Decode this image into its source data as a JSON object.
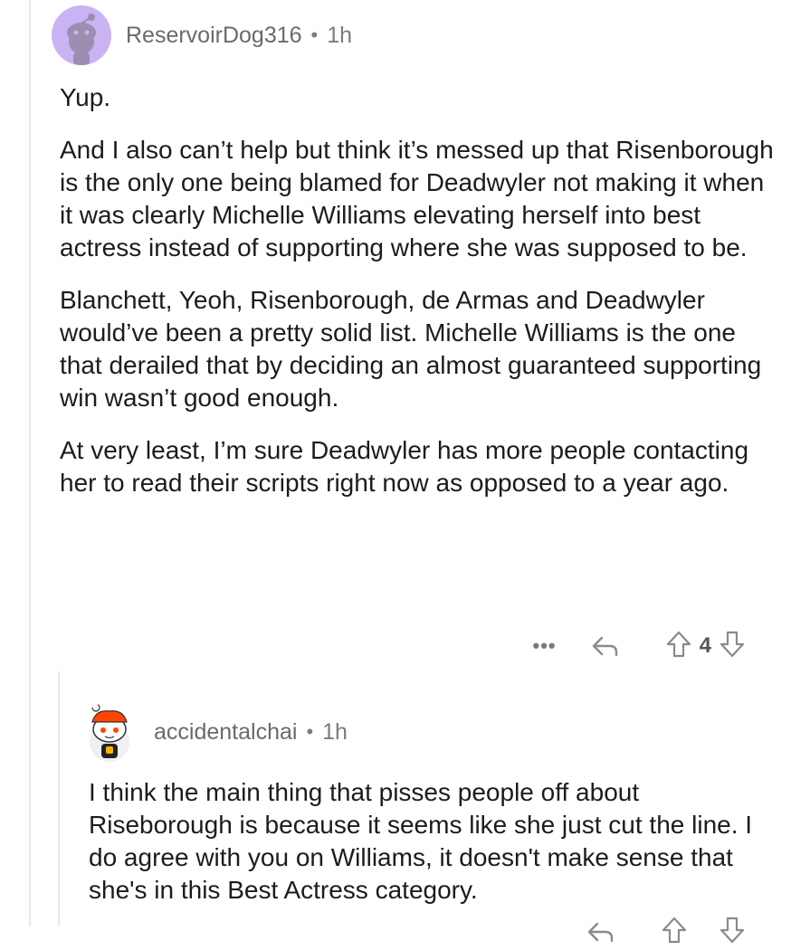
{
  "comments": [
    {
      "username": "ReservoirDog316",
      "separator": "•",
      "time": "1h",
      "paragraphs": [
        "Yup.",
        "And I also can’t help but think it’s messed up that Risenborough is the only one being blamed for Deadwyler not making it when it was clearly Michelle Williams elevating herself into best actress instead of supporting where she was supposed to be.",
        "Blanchett, Yeoh, Risenborough, de Armas and Deadwyler would’ve been a pretty solid list. Michelle Williams is the one that derailed that by deciding an almost guaranteed supporting win wasn’t good enough.",
        "At very least, I’m sure Deadwyler has more people contacting her to read their scripts right now as opposed to a year ago."
      ],
      "actions": {
        "more": "•••",
        "score": "4"
      }
    },
    {
      "username": "accidentalchai",
      "separator": "•",
      "time": "1h",
      "paragraphs": [
        "I think the main thing that pisses people off about Riseborough is because it seems like she just cut the line. I do agree with you on Williams, it doesn't make sense that she's in this Best Actress category."
      ]
    }
  ],
  "colors": {
    "avatar1_bg": "#c9b3f2",
    "snoo_orange": "#ff4500",
    "meta_gray": "#7c7c7c"
  },
  "icons": [
    "reply-icon",
    "upvote-icon",
    "downvote-icon",
    "more-options-icon"
  ]
}
